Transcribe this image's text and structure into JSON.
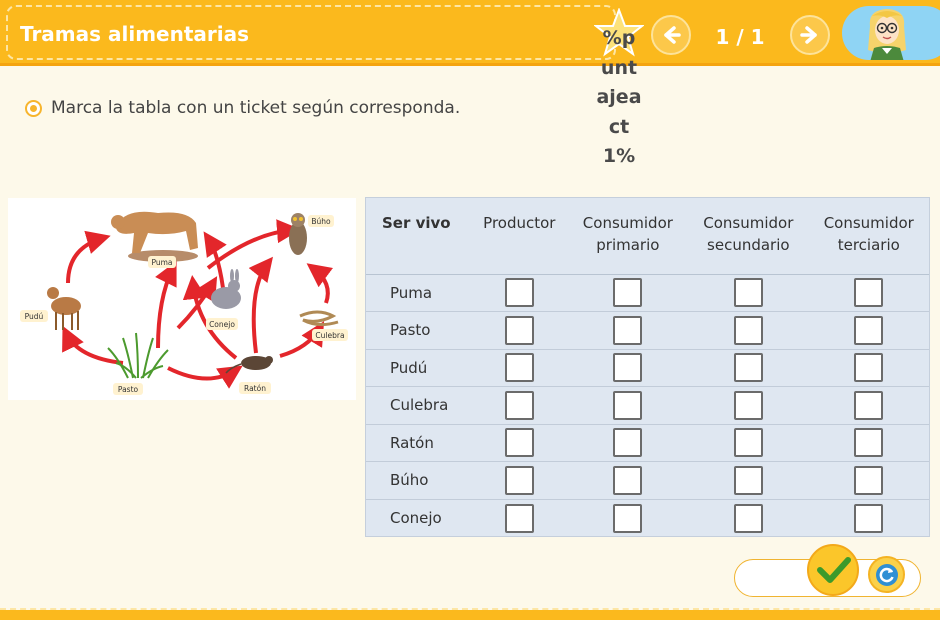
{
  "header": {
    "title": "Tramas alimentarias",
    "score_text": "%puntajeact1%",
    "page_indicator": "1 / 1",
    "prev_icon": "arrow-left-icon",
    "next_icon": "arrow-right-icon"
  },
  "instruction": "Marca la tabla con un ticket según corresponda.",
  "foodweb": {
    "labels": [
      "Búho",
      "Puma",
      "Pudú",
      "Conejo",
      "Culebra",
      "Pasto",
      "Ratón"
    ]
  },
  "table": {
    "headers": [
      {
        "line1": "Ser vivo",
        "line2": ""
      },
      {
        "line1": "Productor",
        "line2": ""
      },
      {
        "line1": "Consumidor",
        "line2": "primario"
      },
      {
        "line1": "Consumidor",
        "line2": "secundario"
      },
      {
        "line1": "Consumidor",
        "line2": "terciario"
      }
    ],
    "rows": [
      "Puma",
      "Pasto",
      "Pudú",
      "Culebra",
      "Ratón",
      "Búho",
      "Conejo"
    ],
    "checked": [
      [
        false,
        false,
        false,
        false
      ],
      [
        false,
        false,
        false,
        false
      ],
      [
        false,
        false,
        false,
        false
      ],
      [
        false,
        false,
        false,
        false
      ],
      [
        false,
        false,
        false,
        false
      ],
      [
        false,
        false,
        false,
        false
      ],
      [
        false,
        false,
        false,
        false
      ]
    ]
  },
  "controls": {
    "check_icon": "checkmark-icon",
    "reset_icon": "refresh-icon"
  },
  "colors": {
    "header_bg": "#fbb91d",
    "table_bg": "#dfe7f1",
    "arrow_red": "#e3262b"
  }
}
